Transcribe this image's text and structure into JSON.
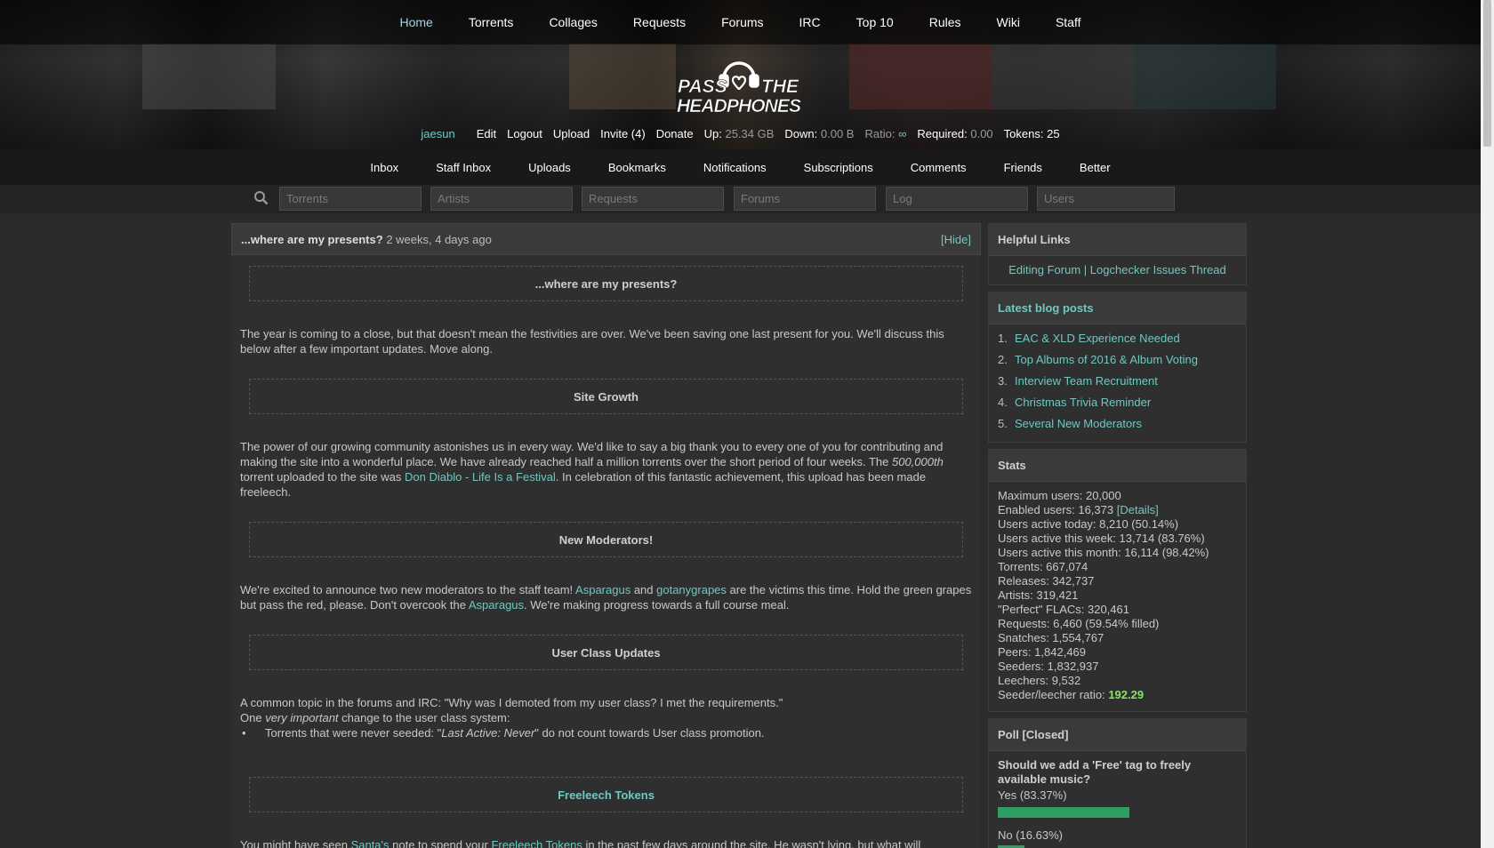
{
  "topnav": {
    "items": [
      "Home",
      "Torrents",
      "Collages",
      "Requests",
      "Forums",
      "IRC",
      "Top 10",
      "Rules",
      "Wiki",
      "Staff"
    ],
    "active": "Home"
  },
  "logo": {
    "line1_left": "PASS",
    "line1_right": "THE",
    "line2": "HEADPHONES"
  },
  "userbar": {
    "username": "jaesun",
    "edit": "Edit",
    "logout": "Logout",
    "upload": "Upload",
    "invite": "Invite (4)",
    "donate": "Donate",
    "up_label": "Up:",
    "up_value": "25.34 GB",
    "down_label": "Down:",
    "down_value": "0.00 B",
    "ratio_label": "Ratio:",
    "ratio_value": "∞",
    "required_label": "Required:",
    "required_value": "0.00",
    "tokens_label": "Tokens:",
    "tokens_value": "25"
  },
  "subnav": {
    "items": [
      "Inbox",
      "Staff Inbox",
      "Uploads",
      "Bookmarks",
      "Notifications",
      "Subscriptions",
      "Comments",
      "Friends",
      "Better"
    ]
  },
  "search": {
    "placeholders": [
      "Torrents",
      "Artists",
      "Requests",
      "Forums",
      "Log",
      "Users"
    ]
  },
  "news": {
    "title": "...where are my presents?",
    "age": "2 weeks, 4 days ago",
    "hide": "[Hide]",
    "section1": "...where are my presents?",
    "para1": "The year is coming to a close, but that doesn't mean the festivities are over. We've been saving one last present for you. We'll discuss this below after a few important updates. Move along.",
    "section2": "Site Growth",
    "para2_a": "The power of our growing community astonishes us in every way. We'd like to say a big thank you to every one of you for contributing and making the site into a wonderful place. We have already reached half a million torrents over the short period of four weeks. The ",
    "para2_em": "500,000th",
    "para2_b": " torrent uploaded to the site was ",
    "para2_link": "Don Diablo - Life Is a Festival",
    "para2_c": ". In celebration of this fantastic achievement, this upload has been made freeleech.",
    "section3": "New Moderators!",
    "para3_a": "We're excited to announce two new moderators to the staff team! ",
    "para3_link1": "Asparagus",
    "para3_b": " and ",
    "para3_link2": "gotanygrapes",
    "para3_c": " are the victims this time. Hold the green grapes but pass the red, please. Don't overcook the ",
    "para3_link3": "Asparagus",
    "para3_d": ". We're making progress towards a full course meal.",
    "section4": "User Class Updates",
    "para4_line1": "A common topic in the forums and IRC: \"Why was I demoted from my user class? I met the requirements.\"",
    "para4_line2_a": "One ",
    "para4_line2_em": "very important",
    "para4_line2_b": " change to the user class system:",
    "para4_bullet_a": "Torrents that were never seeded: \"",
    "para4_bullet_em": "Last Active: Never",
    "para4_bullet_b": "\" do not count towards User class promotion.",
    "section5": "Freeleech Tokens",
    "para5_a": "You might have seen ",
    "para5_link1": "Santa's",
    "para5_b": " note to spend your ",
    "para5_link2": "Freeleech Tokens",
    "para5_c": " in the past few days around the site. He wasn't lying, but what will"
  },
  "sidebar": {
    "helpful_title": "Helpful Links",
    "helpful_link1": "Editing Forum",
    "helpful_sep": "|",
    "helpful_link2": "Logchecker Issues Thread",
    "blog_title": "Latest blog posts",
    "blog_posts": [
      {
        "num": "1.",
        "title": "EAC & XLD Experience Needed"
      },
      {
        "num": "2.",
        "title": "Top Albums of 2016 & Album Voting"
      },
      {
        "num": "3.",
        "title": "Interview Team Recruitment"
      },
      {
        "num": "4.",
        "title": "Christmas Trivia Reminder"
      },
      {
        "num": "5.",
        "title": "Several New Moderators"
      }
    ],
    "stats_title": "Stats",
    "stats": {
      "max_users": "Maximum users: 20,000",
      "enabled_users": "Enabled users: 16,373",
      "details": "[Details]",
      "active_today": "Users active today: 8,210 (50.14%)",
      "active_week": "Users active this week: 13,714 (83.76%)",
      "active_month": "Users active this month: 16,114 (98.42%)",
      "torrents": "Torrents: 667,074",
      "releases": "Releases: 342,737",
      "artists": "Artists: 319,421",
      "perfect_flacs": "\"Perfect\" FLACs: 320,461",
      "requests": "Requests: 6,460 (59.54% filled)",
      "snatches": "Snatches: 1,554,767",
      "peers": "Peers: 1,842,469",
      "seeders": "Seeders: 1,832,937",
      "leechers": "Leechers: 9,532",
      "ratio_label": "Seeder/leecher ratio:",
      "ratio_value": "192.29"
    },
    "poll_title": "Poll [Closed]",
    "poll": {
      "question": "Should we add a 'Free' tag to freely available music?",
      "answer1": "Yes (83.37%)",
      "answer1_pct": 83.37,
      "answer2": "No (16.63%)",
      "answer2_pct": 16.63
    }
  },
  "colors": {
    "link": "#6fc8c0",
    "poll_bar": "#2e9f63",
    "active_nav": "#9fd6ea",
    "stat_highlight": "#8be06a"
  }
}
